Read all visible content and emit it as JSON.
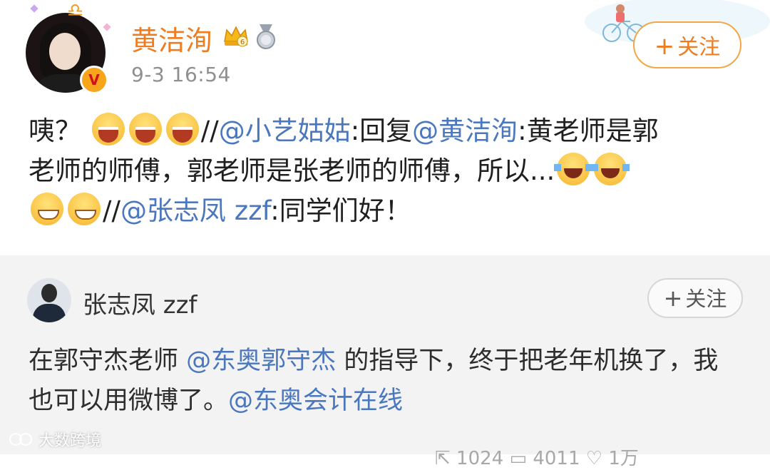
{
  "post": {
    "author": "黄洁洵",
    "timestamp": "9-3 16:54",
    "follow_label": "关注",
    "verified_badge": "V",
    "text": {
      "l1_a": "咦？",
      "l1_b": "//",
      "l1_m1": "@小艺姑姑",
      "l1_c": ":回复",
      "l1_m2": "@黄洁洵",
      "l1_d": ":黄老师是郭",
      "l2_a": "老师的师傅，郭老师是张老师的师傅，所以...",
      "l3_b": "//",
      "l3_m1": "@张志凤 zzf",
      "l3_c": ":同学们好！"
    }
  },
  "repost": {
    "author": "张志凤 zzf",
    "follow_label": "关注",
    "text": {
      "a": "在郭守杰老师",
      "m1": "@东奥郭守杰",
      "b": "的指导下，终于把老年机换了，我也可以用微博了。",
      "m2": "@东奥会计在线"
    },
    "stats": "⇱ 1024   ▭ 4011   ♡ 1万"
  },
  "watermark": "大数跨境",
  "colors": {
    "accent_orange": "#f07c20",
    "mention_blue": "#4b77be",
    "timestamp_gray": "#8f8f8f",
    "repost_bg": "#f3f3f3"
  },
  "icons": [
    "zodiac-libra-icon",
    "crown-level-icon",
    "medal-icon",
    "verified-v-icon",
    "grin-emoji-icon",
    "laugh-tears-emoji-icon",
    "smirk-emoji-icon",
    "plus-icon"
  ]
}
